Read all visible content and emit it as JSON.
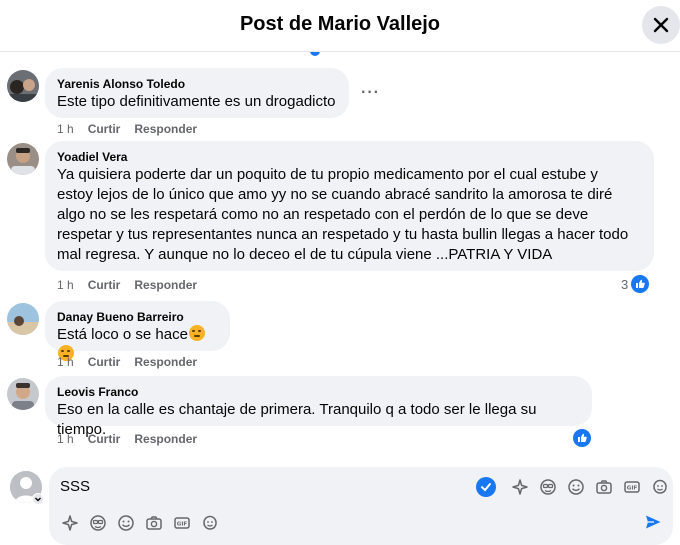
{
  "header": {
    "title": "Post de Mario Vallejo"
  },
  "comments": [
    {
      "author": "Yarenis Alonso Toledo",
      "text": "Este tipo definitivamente es un drogadicto",
      "time": "1 h",
      "like_label": "Curtir",
      "reply_label": "Responder",
      "more": "···"
    },
    {
      "author": "Yoadiel Vera",
      "lines": [
        "Ya quisiera poderte dar un poquito de tu propio medicamento por el cual estube y",
        "estoy lejos de lo único que amo yy no se cuando abracé sandrito la amorosa te diré",
        "algo no se les respetará como no an respetado con el perdón de lo que se deve",
        "respetar y tus representantes nunca an respetado y tu hasta bullin llegas a hacer todo",
        "mal regresa. Y aunque no lo deceo el de tu cúpula viene ...PATRIA Y VIDA"
      ],
      "time": "1 h",
      "like_label": "Curtir",
      "reply_label": "Responder",
      "reaction_count": "3"
    },
    {
      "author": "Danay Bueno Barreiro",
      "text": "Está loco o se hace",
      "time": "1 h",
      "like_label": "Curtir",
      "reply_label": "Responder"
    },
    {
      "author": "Leovis Franco",
      "text": "Eso en la calle es chantaje de primera. Tranquilo q a todo ser le llega su tiempo.",
      "time": "1 h",
      "like_label": "Curtir",
      "reply_label": "Responder"
    }
  ],
  "composer": {
    "value": "SSS"
  },
  "colors": {
    "accent": "#1877f2",
    "bubble": "#f0f2f5",
    "muted": "#65676b"
  }
}
